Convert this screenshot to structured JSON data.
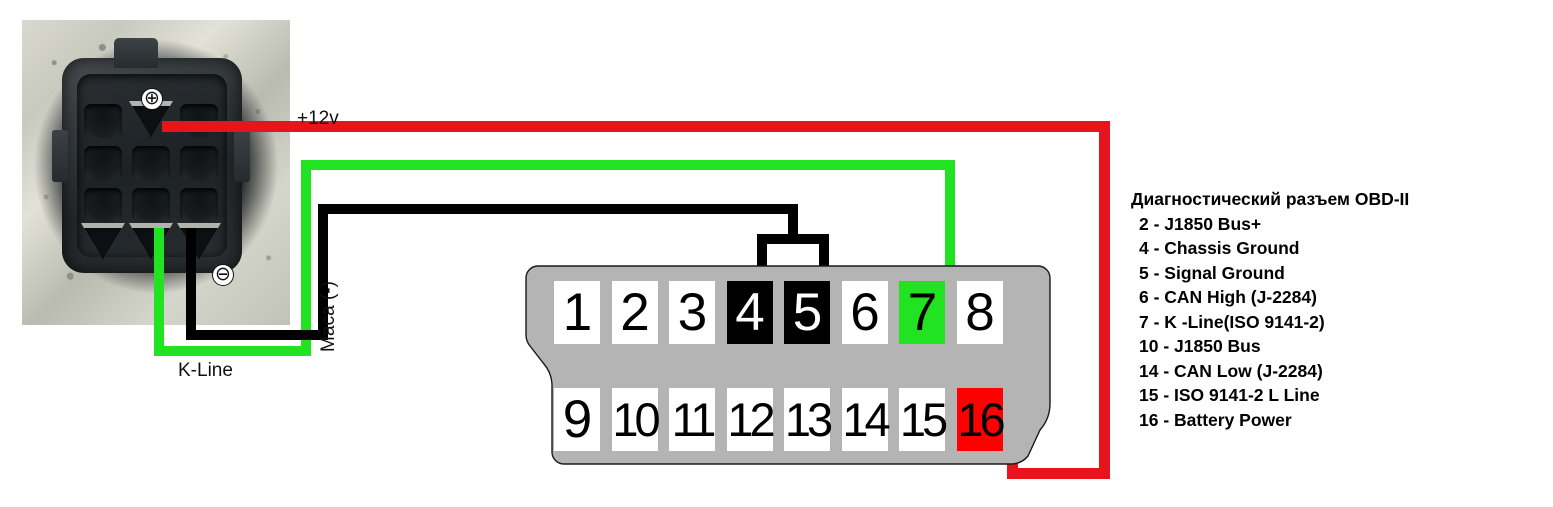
{
  "photo": {
    "alt_name": "9-pin diagnostic connector photo",
    "plus_symbol": "⊕",
    "minus_symbol": "⊖"
  },
  "labels": {
    "power": "+12v",
    "ground": "Маса (-)",
    "kline": "K-Line"
  },
  "colors": {
    "wire_power": "#e8141c",
    "wire_ground": "#000000",
    "wire_kline": "#21e321",
    "pin_highlight_green": "#21e321",
    "pin_highlight_red": "#ff0000",
    "pin_highlight_black": "#000000",
    "connector_body": "#b4b4b4"
  },
  "obd_connector": {
    "name": "OBD-II diagnostic connector",
    "top_row": [
      {
        "number": "1",
        "state": "normal"
      },
      {
        "number": "2",
        "state": "normal"
      },
      {
        "number": "3",
        "state": "normal"
      },
      {
        "number": "4",
        "state": "black"
      },
      {
        "number": "5",
        "state": "black"
      },
      {
        "number": "6",
        "state": "normal"
      },
      {
        "number": "7",
        "state": "green"
      },
      {
        "number": "8",
        "state": "normal"
      }
    ],
    "bottom_row": [
      {
        "number": "9",
        "state": "normal"
      },
      {
        "number": "10",
        "state": "normal"
      },
      {
        "number": "11",
        "state": "normal"
      },
      {
        "number": "12",
        "state": "normal"
      },
      {
        "number": "13",
        "state": "normal"
      },
      {
        "number": "14",
        "state": "normal"
      },
      {
        "number": "15",
        "state": "normal"
      },
      {
        "number": "16",
        "state": "red"
      }
    ]
  },
  "legend": {
    "title": "Диагностический разъем OBD-II",
    "rows": [
      " 2 - J1850 Bus+",
      " 4 - Chassis Ground",
      " 5 - Signal Ground",
      " 6 - CAN High (J-2284)",
      " 7 -  K -Line(ISO 9141-2)",
      "10 - J1850 Bus",
      "14 - CAN Low (J-2284)",
      "15 - ISO 9141-2 L Line",
      "16 - Battery Power"
    ]
  }
}
